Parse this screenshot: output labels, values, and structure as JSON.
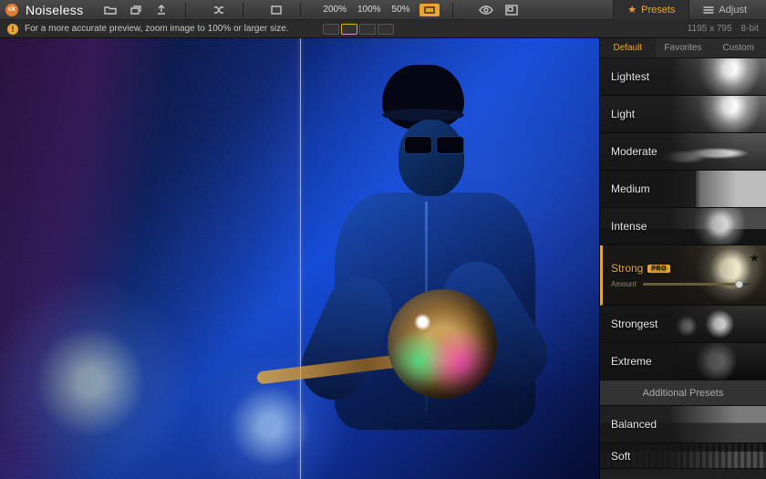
{
  "app": {
    "name": "Noiseless"
  },
  "toolbar": {
    "zoom": [
      "200%",
      "100%",
      "50%"
    ]
  },
  "tabs": {
    "presets": "Presets",
    "adjust": "Adjust"
  },
  "infobar": {
    "tip": "For a more accurate preview, zoom image to 100% or larger size.",
    "dimensions": "1195 x 795",
    "bitdepth": "8-bit"
  },
  "modes": {
    "default": "Default",
    "favorites": "Favorites",
    "custom": "Custom"
  },
  "presets": {
    "items": [
      "Lightest",
      "Light",
      "Moderate",
      "Medium",
      "Intense",
      "Strong",
      "Strongest",
      "Extreme"
    ],
    "pro_badge": "PRO",
    "amount_label": "Amount",
    "additional_header": "Additional Presets",
    "additional": [
      "Balanced",
      "Soft"
    ]
  },
  "colors": {
    "accent": "#e7a534",
    "brand": "#e27a2f"
  }
}
